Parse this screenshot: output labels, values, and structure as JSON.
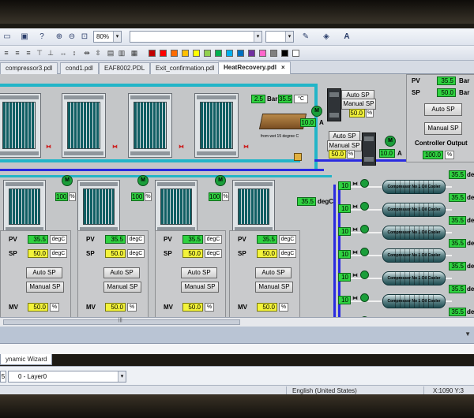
{
  "toolbar": {
    "zoom": "80%",
    "colors": [
      "#c00000",
      "#ff0000",
      "#ff6a00",
      "#ffc000",
      "#ffff00",
      "#92d050",
      "#00b050",
      "#00b0f0",
      "#0070c0",
      "#7030a0",
      "#ff66cc",
      "#808080",
      "#000000",
      "#ffffff"
    ]
  },
  "tabs": [
    {
      "label": "compressor3.pdl"
    },
    {
      "label": "cond1.pdl"
    },
    {
      "label": "EAF8002.PDL"
    },
    {
      "label": "Exit_confirmation.pdl"
    },
    {
      "label": "HeatRecovery.pdl",
      "close": "×"
    }
  ],
  "hmi": {
    "pressure": {
      "value": "2.5",
      "unit": "Bar"
    },
    "temperature": {
      "value": "35.5",
      "unit": "°C"
    },
    "tank_caption": "from wet 15 degree C",
    "motor_label": "M",
    "current_top": {
      "value": "10.0",
      "unit": "A"
    },
    "current_right": {
      "value": "10.0",
      "unit": "A"
    },
    "auto_sp": "Auto SP",
    "manual_sp": "Manual SP",
    "mv_top": {
      "value": "50.0",
      "unit": "%"
    },
    "mv_mid": {
      "value": "50.0",
      "unit": "%"
    },
    "controller": {
      "pv_label": "PV",
      "pv_value": "35.5",
      "pv_unit": "Bar",
      "sp_label": "SP",
      "sp_value": "50.0",
      "sp_unit": "Bar",
      "output_label": "Controller Output",
      "output_value": "100.0",
      "output_unit": "%"
    },
    "inlet_temp": {
      "value": "35.5",
      "unit": "degC"
    },
    "pump_pct": "100",
    "pct_unit": "%",
    "units": [
      {
        "pv_label": "PV",
        "pv": "35.5",
        "pv_unit": "degC",
        "sp_label": "SP",
        "sp": "50.0",
        "sp_unit": "degC",
        "mv_label": "MV",
        "mv": "50.0",
        "mv_unit": "%"
      },
      {
        "pv_label": "PV",
        "pv": "35.5",
        "pv_unit": "degC",
        "sp_label": "SP",
        "sp": "50.0",
        "sp_unit": "degC",
        "mv_label": "MV",
        "mv": "50.0",
        "mv_unit": "%"
      },
      {
        "pv_label": "PV",
        "pv": "35.5",
        "pv_unit": "degC",
        "sp_label": "SP",
        "sp": "50.0",
        "sp_unit": "degC",
        "mv_label": "MV",
        "mv": "50.0",
        "mv_unit": "%"
      },
      {
        "pv_label": "PV",
        "pv": "35.5",
        "pv_unit": "degC",
        "sp_label": "SP",
        "sp": "50.0",
        "sp_unit": "degC",
        "mv_label": "MV",
        "mv": "50.0",
        "mv_unit": "%"
      }
    ],
    "coolers": [
      {
        "label": "Compressor No 1 Oil Cooler",
        "flow": "10",
        "temp": "35.5",
        "temp_unit": "deg"
      },
      {
        "label": "Compressor No 1 Oil Cooler",
        "flow": "10",
        "temp": "35.5",
        "temp_unit": "deg"
      },
      {
        "label": "Compressor No 1 Oil Cooler",
        "flow": "10",
        "temp": "35.5",
        "temp_unit": "deg"
      },
      {
        "label": "Compressor No 1 Oil Cooler",
        "flow": "10",
        "temp": "35.5",
        "temp_unit": "deg"
      },
      {
        "label": "Compressor No 1 Oil Cooler",
        "flow": "10",
        "temp": "35.5",
        "temp_unit": "deg"
      },
      {
        "label": "Compressor No 1 Oil Cooler",
        "flow": "10",
        "temp": "35.5",
        "temp_unit": "deg"
      },
      {
        "label": "Compressor No 1 Oil Cooler",
        "flow": "10",
        "temp": "35.5",
        "temp_unit": "deg"
      }
    ]
  },
  "panel": {
    "wizard_tab": "ynamic Wizard",
    "layer": "0 - Layer0",
    "layer_box": "5"
  },
  "status": {
    "language": "English (United States)",
    "coords": "X:1090 Y:3"
  }
}
